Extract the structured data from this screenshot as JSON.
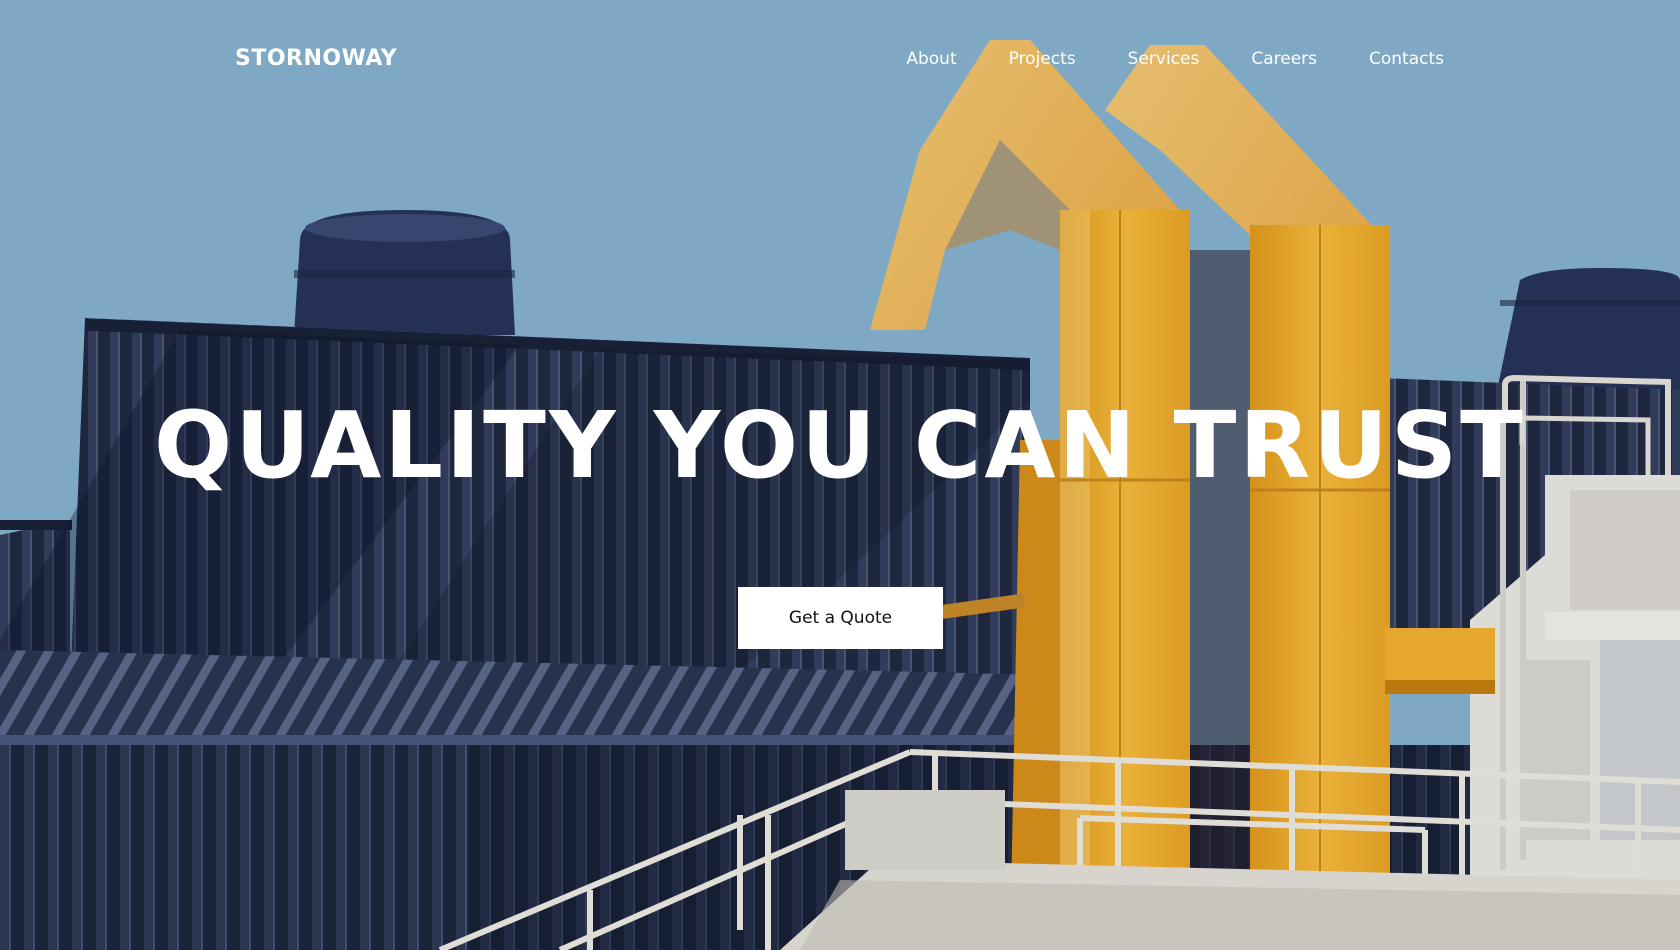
{
  "brand": {
    "name": "STORNOWAY"
  },
  "nav": {
    "items": [
      {
        "label": "About"
      },
      {
        "label": "Projects"
      },
      {
        "label": "Services"
      },
      {
        "label": "Careers"
      },
      {
        "label": "Contacts"
      }
    ]
  },
  "hero": {
    "headline": "QUALITY YOU CAN TRUST",
    "cta_label": "Get a Quote"
  },
  "colors": {
    "sky": "#86b1cf",
    "cladding": "#253049",
    "duct": "#f2b132",
    "railing": "#e7e4dc",
    "text": "#ffffff",
    "button_bg": "#ffffff",
    "button_text": "#111111"
  }
}
